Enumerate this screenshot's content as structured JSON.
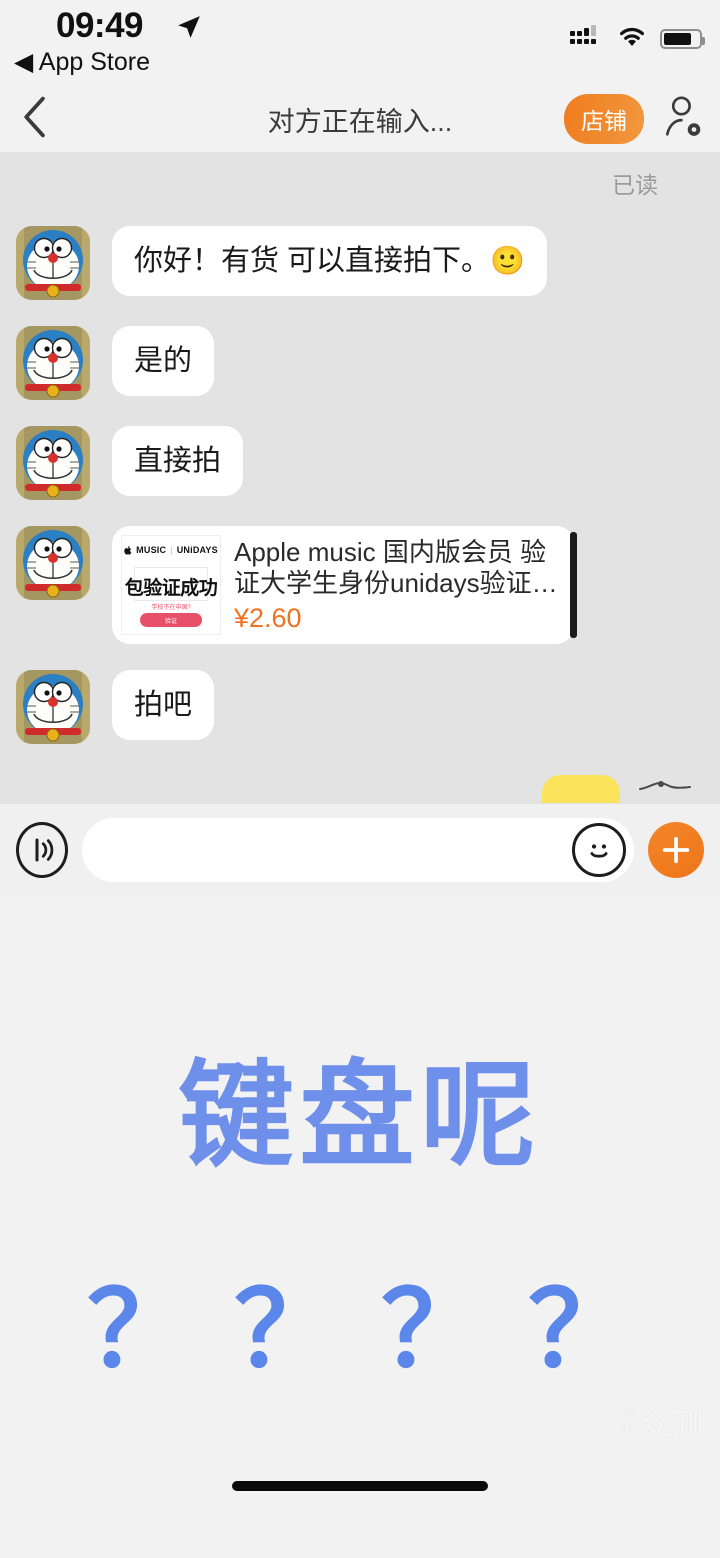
{
  "status_bar": {
    "time": "09:49",
    "location_icon": "location-arrow-icon",
    "back_label": "◀ App Store",
    "signal_icon": "cellular-signal-icon",
    "wifi_icon": "wifi-icon",
    "battery_icon": "battery-icon"
  },
  "nav": {
    "back_icon": "chevron-left-icon",
    "title": "对方正在输入...",
    "shop_label": "店铺",
    "profile_icon": "person-settings-icon"
  },
  "chat": {
    "read_receipt": "已读",
    "avatar_name": "doraemon-avatar",
    "messages": [
      {
        "type": "text",
        "text": "你好！有货 可以直接拍下。",
        "emoji": "🙂"
      },
      {
        "type": "text",
        "text": "是的",
        "emoji": ""
      },
      {
        "type": "text",
        "text": "直接拍",
        "emoji": ""
      },
      {
        "type": "product",
        "thumb_brand_apple": "MUSIC",
        "thumb_brand_sep": "|",
        "thumb_brand_unidays": "UNiDAYS",
        "thumb_headline": "包验证成功",
        "thumb_sub": "学校不在中国?",
        "thumb_button": "验证",
        "title": "Apple music 国内版会员 验证大学生身份unidays验证苹…",
        "price": "¥2.60"
      },
      {
        "type": "text",
        "text": "拍吧",
        "emoji": ""
      }
    ]
  },
  "input_bar": {
    "voice_icon": "voice-wave-icon",
    "input_value": "",
    "input_placeholder": "",
    "emoji_icon": "smiley-face-icon",
    "plus_icon": "plus-icon"
  },
  "keyboard_area": {
    "headline": "键盘呢",
    "question_marks": "？？？？",
    "watermark_small": "新浪",
    "watermark_large": "众测"
  },
  "colors": {
    "accent_orange": "#f07c1e",
    "price_orange": "#f1711f",
    "blue_text": "#6f90ea",
    "chat_bg": "#e3e3e3",
    "bar_bg": "#f2f2f2"
  }
}
